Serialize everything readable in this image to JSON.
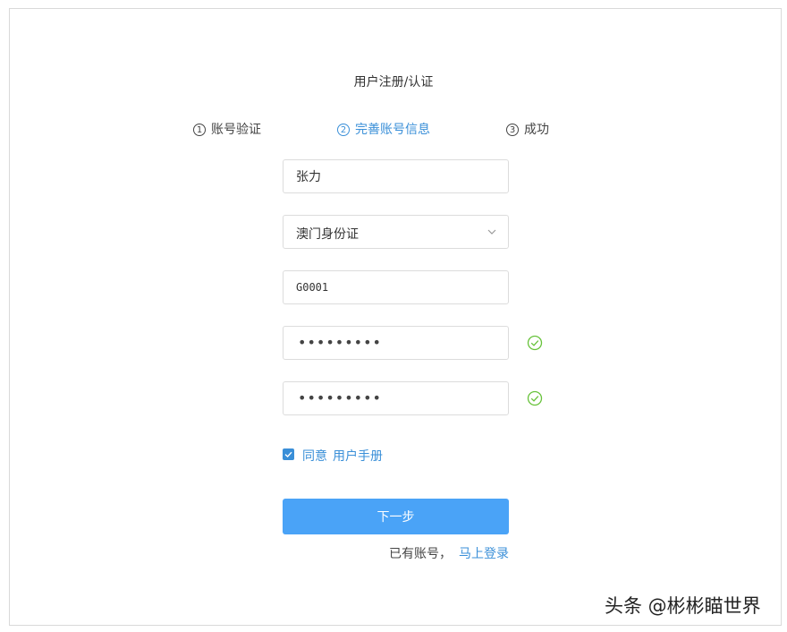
{
  "title": "用户注册/认证",
  "steps": [
    {
      "num": "1",
      "label": "账号验证"
    },
    {
      "num": "2",
      "label": "完善账号信息"
    },
    {
      "num": "3",
      "label": "成功"
    }
  ],
  "form": {
    "name_value": "张力",
    "id_type_value": "澳门身份证",
    "id_number_value": "G0001",
    "password_mask": "•••••••••",
    "confirm_password_mask": "•••••••••"
  },
  "agree": {
    "label": "同意",
    "link": "用户手册"
  },
  "next_button": "下一步",
  "login": {
    "prompt": "已有账号，",
    "link": "马上登录"
  },
  "watermark": "头条 @彬彬瞄世界",
  "colors": {
    "accent": "#3a8fd8",
    "button": "#4aa3f7",
    "success": "#67c23a"
  }
}
